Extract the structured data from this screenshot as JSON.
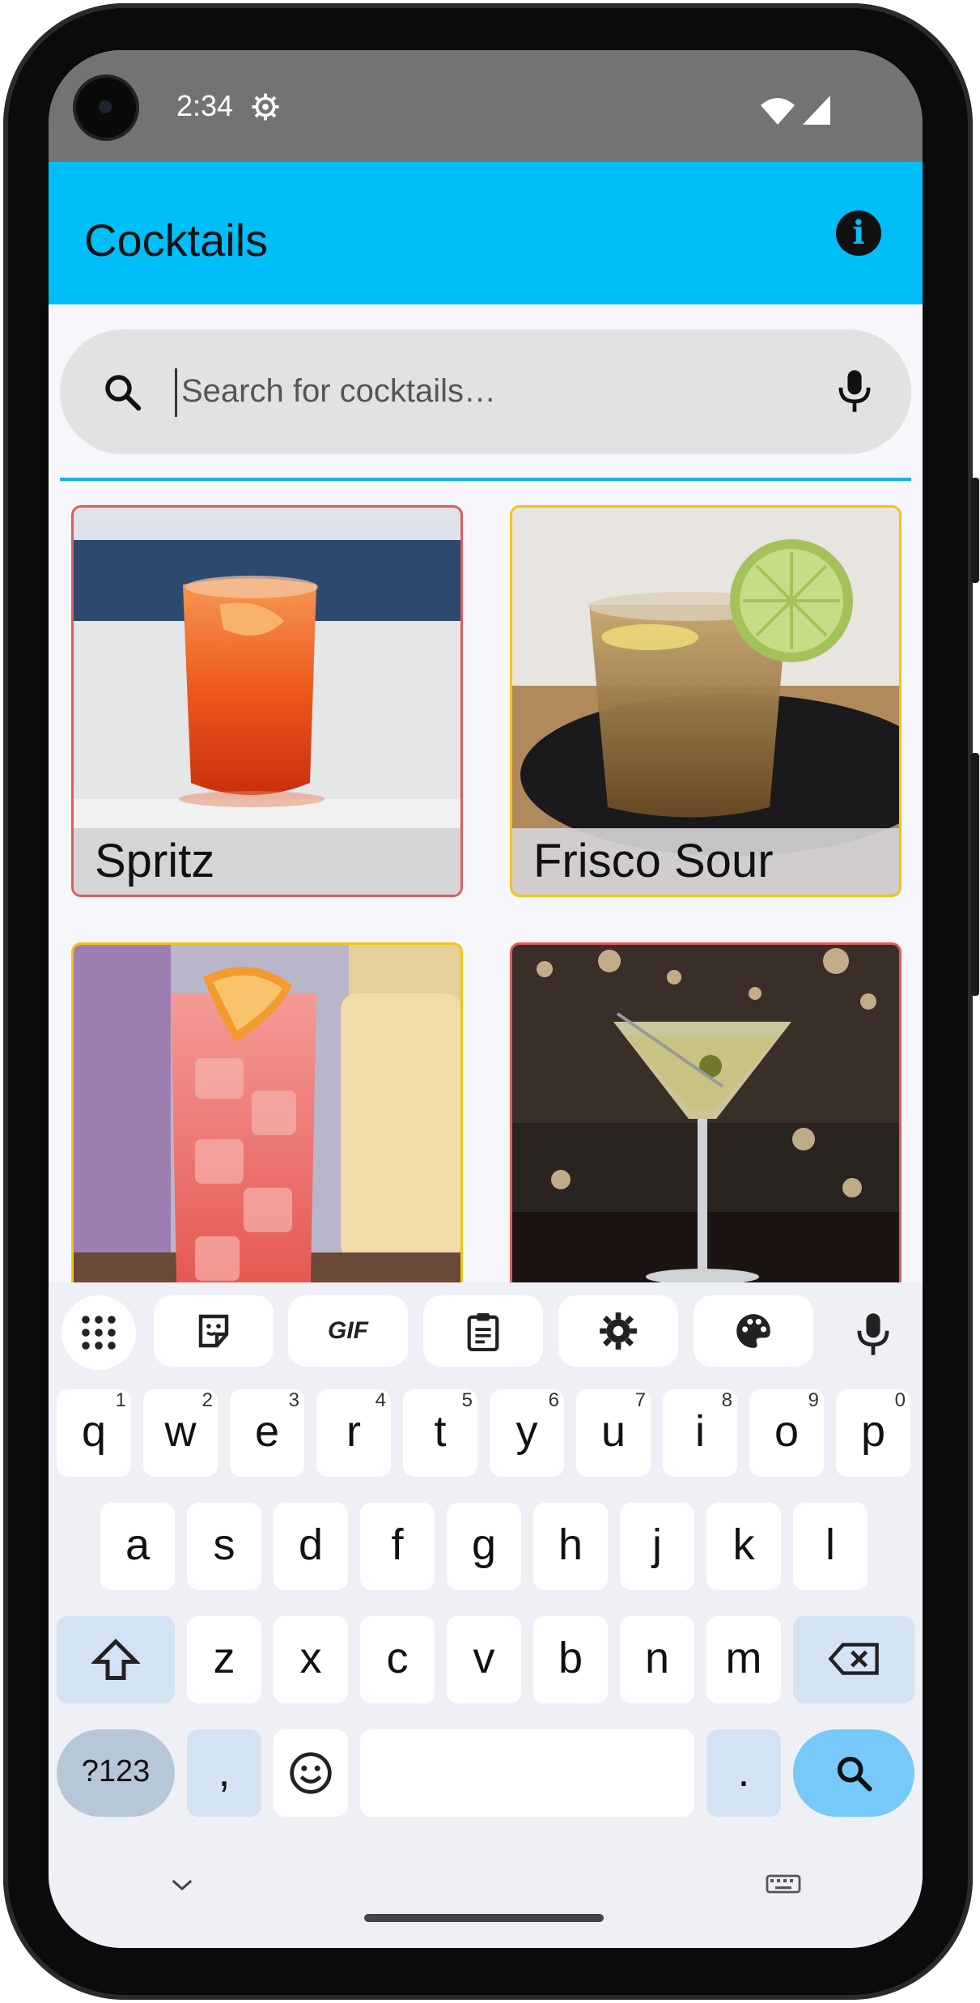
{
  "status_bar": {
    "time": "2:34"
  },
  "app_bar": {
    "title": "Cocktails"
  },
  "search": {
    "placeholder": "Search for cocktails…"
  },
  "cocktails": [
    {
      "name": "Spritz",
      "border": "#e15b5b"
    },
    {
      "name": "Frisco Sour",
      "border": "#f3c316"
    },
    {
      "name": "",
      "border": "#f3c316"
    },
    {
      "name": "",
      "border": "#e15b5b"
    }
  ],
  "keyboard": {
    "toolbar": [
      "apps-grid-icon",
      "sticker-icon",
      "GIF",
      "clipboard-icon",
      "gear-icon",
      "palette-icon",
      "mic-icon"
    ],
    "row1": [
      {
        "key": "q",
        "hint": "1"
      },
      {
        "key": "w",
        "hint": "2"
      },
      {
        "key": "e",
        "hint": "3"
      },
      {
        "key": "r",
        "hint": "4"
      },
      {
        "key": "t",
        "hint": "5"
      },
      {
        "key": "y",
        "hint": "6"
      },
      {
        "key": "u",
        "hint": "7"
      },
      {
        "key": "i",
        "hint": "8"
      },
      {
        "key": "o",
        "hint": "9"
      },
      {
        "key": "p",
        "hint": "0"
      }
    ],
    "row2": [
      "a",
      "s",
      "d",
      "f",
      "g",
      "h",
      "j",
      "k",
      "l"
    ],
    "row3": [
      "z",
      "x",
      "c",
      "v",
      "b",
      "n",
      "m"
    ],
    "symbols_label": "?123",
    "comma": ",",
    "period": "."
  },
  "colors": {
    "accent": "#00bff8",
    "divider": "#18aee8",
    "statusbar": "#737373"
  }
}
